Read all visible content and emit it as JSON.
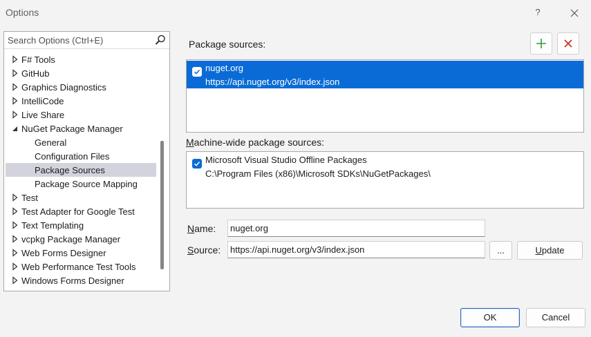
{
  "window": {
    "title": "Options",
    "help_label": "?"
  },
  "search": {
    "placeholder": "Search Options (Ctrl+E)"
  },
  "tree": {
    "items": [
      {
        "label": "F# Tools",
        "level": 0,
        "expanded": false
      },
      {
        "label": "GitHub",
        "level": 0,
        "expanded": false
      },
      {
        "label": "Graphics Diagnostics",
        "level": 0,
        "expanded": false
      },
      {
        "label": "IntelliCode",
        "level": 0,
        "expanded": false
      },
      {
        "label": "Live Share",
        "level": 0,
        "expanded": false
      },
      {
        "label": "NuGet Package Manager",
        "level": 0,
        "expanded": true
      },
      {
        "label": "General",
        "level": 1
      },
      {
        "label": "Configuration Files",
        "level": 1
      },
      {
        "label": "Package Sources",
        "level": 1,
        "selected": true
      },
      {
        "label": "Package Source Mapping",
        "level": 1
      },
      {
        "label": "Test",
        "level": 0,
        "expanded": false
      },
      {
        "label": "Test Adapter for Google Test",
        "level": 0,
        "expanded": false
      },
      {
        "label": "Text Templating",
        "level": 0,
        "expanded": false
      },
      {
        "label": "vcpkg Package Manager",
        "level": 0,
        "expanded": false
      },
      {
        "label": "Web Forms Designer",
        "level": 0,
        "expanded": false
      },
      {
        "label": "Web Performance Test Tools",
        "level": 0,
        "expanded": false
      },
      {
        "label": "Windows Forms Designer",
        "level": 0,
        "expanded": false
      }
    ]
  },
  "package_sources": {
    "heading": "Package sources:",
    "items": [
      {
        "name": "nuget.org",
        "url": "https://api.nuget.org/v3/index.json",
        "checked": true,
        "selected": true
      }
    ]
  },
  "machine_sources": {
    "heading_underlined": "M",
    "heading_rest": "achine-wide package sources:",
    "items": [
      {
        "name": "Microsoft Visual Studio Offline Packages",
        "url": "C:\\Program Files (x86)\\Microsoft SDKs\\NuGetPackages\\",
        "checked": true
      }
    ]
  },
  "form": {
    "name_label_underlined": "N",
    "name_label_rest": "ame:",
    "name_value": "nuget.org",
    "source_label_underlined": "S",
    "source_label_rest": "ource:",
    "source_value": "https://api.nuget.org/v3/index.json",
    "browse_label": "...",
    "update_label_underlined": "U",
    "update_label_rest": "pdate"
  },
  "footer": {
    "ok_label": "OK",
    "cancel_label": "Cancel"
  },
  "colors": {
    "accent": "#0a6bd6",
    "add_icon": "#2f9e2f",
    "remove_icon": "#c42b1c",
    "tree_selection": "#d3d3dd"
  }
}
